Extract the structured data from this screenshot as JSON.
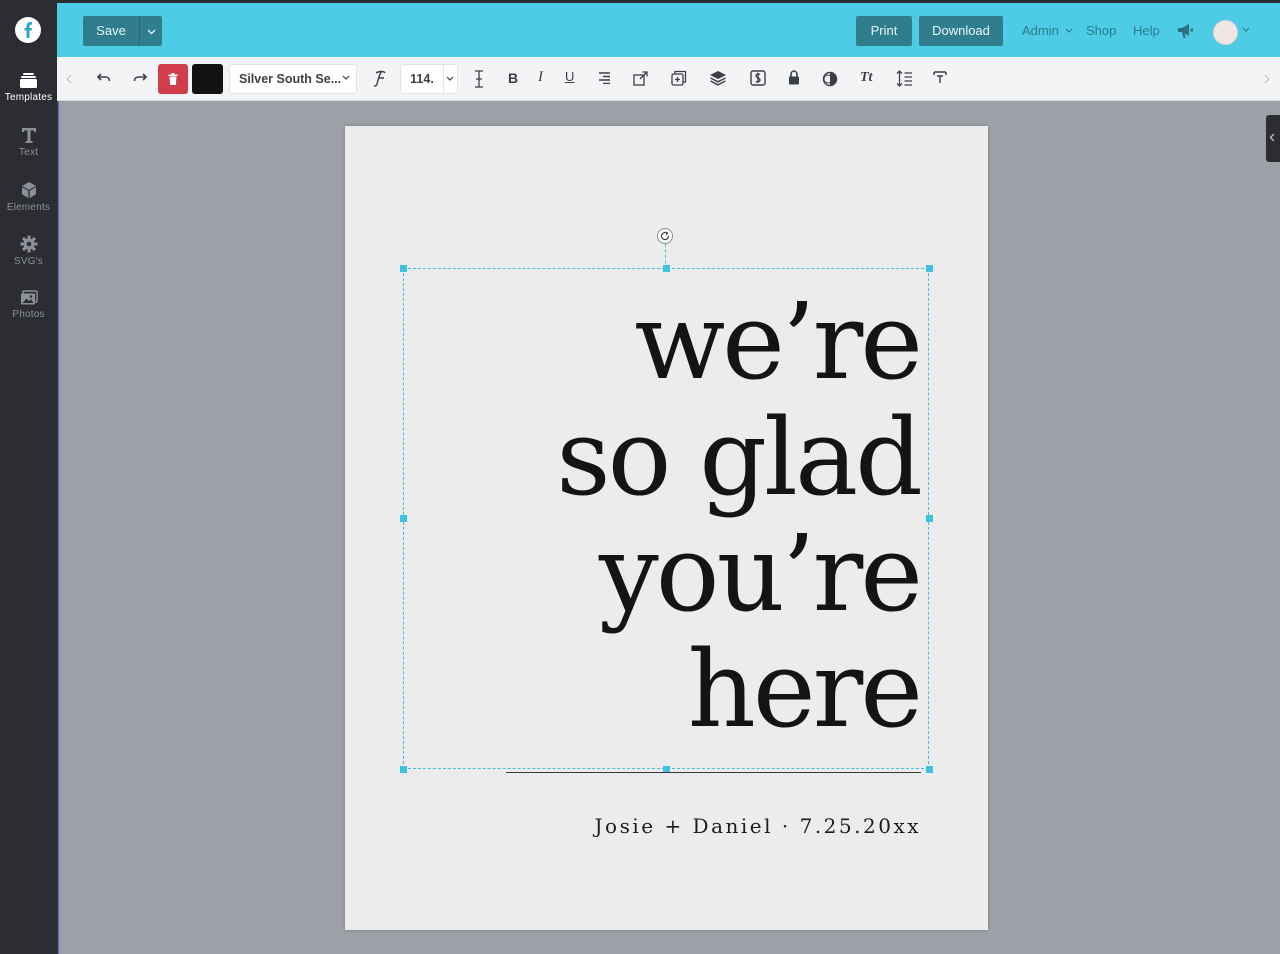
{
  "app": {
    "accent": "#4ecbe5",
    "rail_bg": "#2b2d33",
    "button_bg": "#2f7d8d",
    "delete_color": "#d23d4c"
  },
  "sidebar": {
    "items": [
      {
        "label": "Templates",
        "icon": "templates-icon"
      },
      {
        "label": "Text",
        "icon": "text-icon"
      },
      {
        "label": "Elements",
        "icon": "elements-icon"
      },
      {
        "label": "SVG's",
        "icon": "gear-icon"
      },
      {
        "label": "Photos",
        "icon": "photos-icon"
      }
    ]
  },
  "header": {
    "save_label": "Save",
    "print_label": "Print",
    "download_label": "Download",
    "admin_label": "Admin",
    "shop_label": "Shop",
    "help_label": "Help"
  },
  "toolbar": {
    "text_color": "#111214",
    "font_name": "Silver South Se...",
    "font_size": "114.",
    "bold_glyph": "B",
    "italic_glyph": "I",
    "underline_glyph": "U",
    "case_glyph": "Tt"
  },
  "document": {
    "headline_lines": [
      "we’re",
      "so  glad",
      "you’re",
      "here"
    ],
    "byline": "Josie + Daniel · 7.25.20xx",
    "page_color": "#ececec",
    "text_color": "#141414"
  }
}
